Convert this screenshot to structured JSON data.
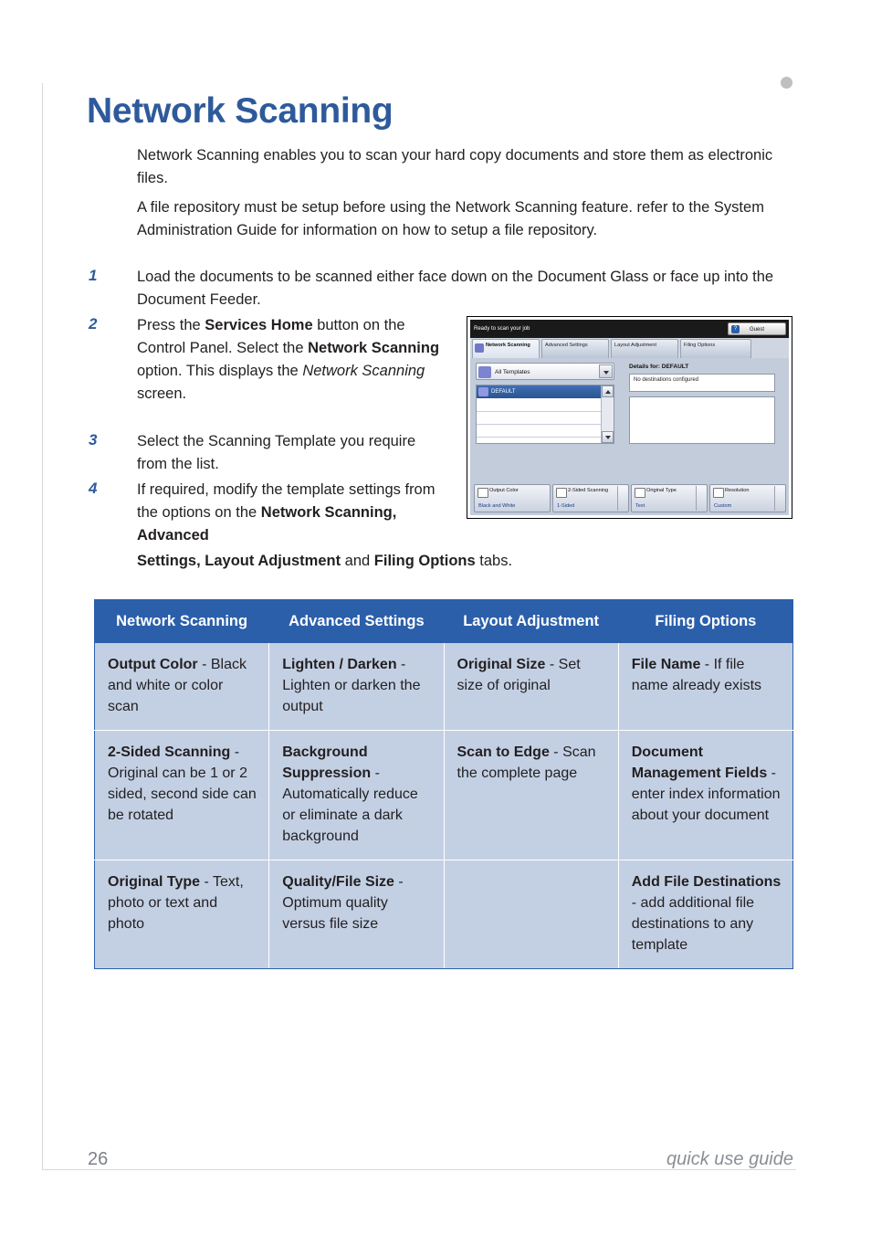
{
  "document": {
    "title": "Network Scanning",
    "intro_1": "Network Scanning enables you to scan your hard copy documents and store them as electronic files.",
    "intro_2": "A file repository must be setup before using the Network Scanning feature. refer to the System Administration Guide for information on how to setup a file repository.",
    "steps": [
      {
        "num": "1",
        "text": "Load the documents to be scanned either face down on the Document Glass or face up into the Document Feeder."
      },
      {
        "num": "2",
        "text": "Press the Services Home button on the Control Panel. Select the Network Scanning option. This displays the Network Scanning screen."
      },
      {
        "num": "3",
        "text": "Select the Scanning Template you require from the list."
      },
      {
        "num": "4",
        "text": "If required, modify the template settings from the options on the Network Scanning, Advanced Settings, Layout Adjustment and Filing Options tabs."
      }
    ]
  },
  "panel": {
    "status": "Ready to scan your job",
    "guest_button": "Guest",
    "tabs": [
      "Network Scanning",
      "Advanced Settings",
      "Layout Adjustment",
      "Filing Options"
    ],
    "template_select": "All Templates",
    "template_row": "DEFAULT",
    "details_title": "Details for: DEFAULT",
    "details_text": "No destinations configured",
    "buttons": [
      {
        "label": "Output Color",
        "value": "Black and White"
      },
      {
        "label": "2-Sided Scanning",
        "value": "1-Sided"
      },
      {
        "label": "Original Type",
        "value": "Text"
      },
      {
        "label": "Resolution",
        "value": "Custom"
      }
    ]
  },
  "table": {
    "headers": [
      "Network Scanning",
      "Advanced Settings",
      "Layout Adjustment",
      "Filing Options"
    ],
    "rows": [
      [
        {
          "bold": "Output Color",
          "rest": " - Black and white or color scan"
        },
        {
          "bold": "Lighten / Darken",
          "rest": " - Lighten or darken the output"
        },
        {
          "bold": "Original Size",
          "rest": " - Set size of original"
        },
        {
          "bold": "File Name",
          "rest": " - If file name already exists"
        }
      ],
      [
        {
          "bold": "2-Sided Scanning",
          "rest": " - Original can be 1 or 2 sided, second side can be rotated"
        },
        {
          "bold": "Background Suppression",
          "rest": " - Automatically reduce or eliminate a dark background"
        },
        {
          "bold": "Scan to Edge",
          "rest": " - Scan the complete page"
        },
        {
          "bold": "Document Management Fields",
          "rest": " - enter index information about your document"
        }
      ],
      [
        {
          "bold": "Original Type",
          "rest": " - Text, photo or text and photo"
        },
        {
          "bold": "Quality/File Size",
          "rest": " - Optimum quality versus file size"
        },
        {
          "bold": "",
          "rest": ""
        },
        {
          "bold": "Add File Destinations",
          "rest": " - add additional file destinations to any template"
        }
      ]
    ]
  },
  "footer": {
    "page_number": "26",
    "guide_label": "quick use guide"
  }
}
